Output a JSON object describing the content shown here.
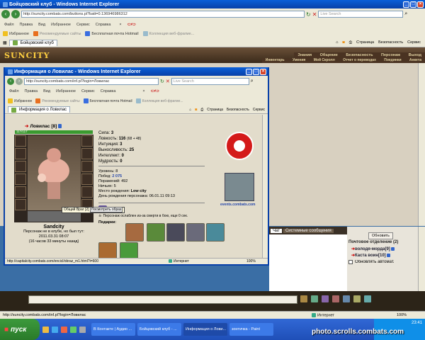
{
  "main_window": {
    "title": "Бойцовский клуб - Windows Internet Explorer",
    "address": "http://suncity.combats.com/buttons.pl?batt=0.136946986312",
    "search_placeholder": "Live Search",
    "menu": [
      "Файл",
      "Правка",
      "Вид",
      "Избранное",
      "Сервис",
      "Справка"
    ],
    "favorites_label": "Избранное",
    "links": [
      "Рекомендуемые сайты",
      "Бесплатная почта Hotmail",
      "Коллекция веб-фрагме..."
    ],
    "tab": "Бойцовский клуб",
    "cmd": [
      "Страница",
      "Безопасность",
      "Сервис"
    ],
    "status_url": "http://suncity.combats.com/inf.pl?login=Ловилас",
    "status_zone": "Интернет",
    "zoom": "100%"
  },
  "game": {
    "logo": "SUNCITY",
    "nav_top": [
      "Знания",
      "Общение",
      "Безопасность",
      "Персонаж",
      "Выход"
    ],
    "nav_bottom": [
      "Инвентарь",
      "Умения",
      "Мой Скролл",
      "Отчет о переводах",
      "Поединки",
      "Анкета"
    ],
    "chat_tab": "Чат",
    "sys_tab": "Системные сообщения",
    "refresh_label": "Обновить",
    "post_title": "Почтовое отделение (2)",
    "users": [
      {
        "name": "володя-морда",
        "level": "[9]"
      },
      {
        "name": "Каста воин",
        "level": "[10]"
      }
    ],
    "auto_refresh": "Обновлять автомат."
  },
  "popup": {
    "title": "Информация о Ловилас - Windows Internet Explorer",
    "address": "http://suncity.combats.com/inf.pl?login=Ловилас",
    "search_placeholder": "Live Search",
    "menu": [
      "Файл",
      "Правка",
      "Вид",
      "Избранное",
      "Сервис",
      "Справка"
    ],
    "favorites_label": "Избранное",
    "links": [
      "Рекомендуемые сайты",
      "Бесплатная почта Hotmail",
      "Коллекция веб-фрагме..."
    ],
    "tab": "Информация о Ловилас",
    "cmd": [
      "Страница",
      "Безопасность",
      "Сервис"
    ],
    "status_url": "http://capitalcity.combats.com/encicl/obraz_m1.html?i=600",
    "status_zone": "Интернет",
    "zoom": "100%",
    "character": {
      "name": "Ловилас",
      "level": "[8]",
      "hp": "117/117",
      "city": "Sandcity",
      "offline_text": "Персонаж не в клубе, но был тут:",
      "last_seen": "2011.03.31 08:07",
      "ago": "(16 часов 33 минуты назад)",
      "tooltip_gift": "Общий Враг [2]",
      "tooltip_view": "Посмотреть образ",
      "stats": [
        {
          "label": "Сила:",
          "value": "3",
          "extra": ""
        },
        {
          "label": "Ловкость:",
          "value": "116",
          "extra": "(68 + 48)"
        },
        {
          "label": "Интуиция:",
          "value": "3",
          "extra": ""
        },
        {
          "label": "Выносливость:",
          "value": "25",
          "extra": ""
        },
        {
          "label": "Интеллект:",
          "value": "0",
          "extra": ""
        },
        {
          "label": "Мудрость:",
          "value": "0",
          "extra": ""
        }
      ],
      "info": [
        {
          "label": "Уровень:",
          "value": "8"
        },
        {
          "label": "Побед:",
          "value": "2 075"
        },
        {
          "label": "Поражений:",
          "value": "492"
        },
        {
          "label": "Ничьих:",
          "value": "5"
        },
        {
          "label": "Место рождения:",
          "value": "Low city"
        },
        {
          "label": "День рождения персонажа:",
          "value": "06.01.11 09:13"
        }
      ],
      "weak_note": "Персонаж ослаблен из-за смерти в бою, еще 0 сек.",
      "gifts_label": "Подарки:",
      "events_link": "events.combats.com"
    }
  },
  "taskbar": {
    "start": "пуск",
    "tasks": [
      "В Контакте | Аудио ...",
      "Бойцовский клуб - ...",
      "Информация о Лови...",
      "зонтичка - Paint"
    ],
    "time": "23:41",
    "watermark": "photo.scrolls.combats.com"
  },
  "colors": {
    "ie_title": "#0a5fd8",
    "stat_blue": "#2244aa",
    "hp_green": "#3a9a30",
    "game_dark": "#2c2418"
  }
}
